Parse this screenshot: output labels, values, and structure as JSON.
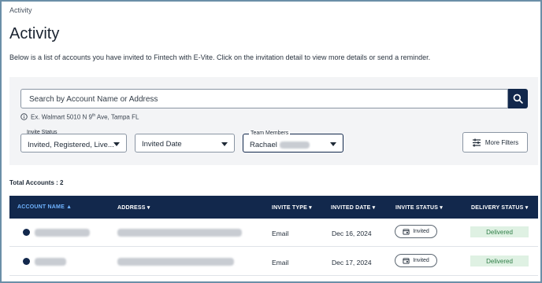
{
  "breadcrumb": "Activity",
  "page_title": "Activity",
  "description": "Below is a list of accounts you have invited to Fintech with E-Vite. Click on the invitation detail to view more details or send a reminder.",
  "search": {
    "placeholder": "Search by Account Name or Address",
    "hint_prefix": "Ex. Walmart 5010 N 9",
    "hint_sup": "th",
    "hint_suffix": " Ave, Tampa FL"
  },
  "filters": {
    "invite_status_label": "Invite Status",
    "invite_status_value": "Invited, Registered, Live...",
    "date_value": "Invited Date",
    "team_members_label": "Team Members",
    "team_members_value": "Rachael",
    "more_filters": "More Filters"
  },
  "total_accounts": "Total Accounts : 2",
  "table": {
    "headers": {
      "account_name": "ACCOUNT NAME",
      "address": "ADDRESS",
      "invite_type": "INVITE TYPE",
      "invited_date": "INVITED DATE",
      "invite_status": "INVITE STATUS",
      "delivery_status": "DELIVERY STATUS"
    },
    "rows": [
      {
        "invite_type": "Email",
        "invited_date": "Dec 16, 2024",
        "invite_status": "Invited",
        "delivery_status": "Delivered"
      },
      {
        "invite_type": "Email",
        "invited_date": "Dec 17, 2024",
        "invite_status": "Invited",
        "delivery_status": "Delivered"
      }
    ]
  },
  "colors": {
    "navy": "#12284c",
    "sorted_header": "#6fb3ff",
    "delivered_bg": "#dff1e3",
    "delivered_text": "#2e7d46"
  }
}
